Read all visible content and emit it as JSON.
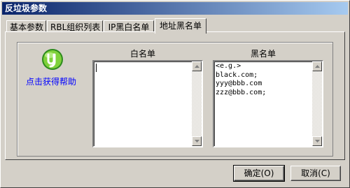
{
  "window": {
    "title": "反垃圾参数"
  },
  "tabs": [
    {
      "label": "基本参数"
    },
    {
      "label": "RBL组织列表"
    },
    {
      "label": "IP黑白名单"
    },
    {
      "label": "地址黑名单",
      "active": true
    }
  ],
  "help": {
    "icon": "help-book-icon",
    "label": "点击获得帮助"
  },
  "whitelist": {
    "label": "白名单",
    "text": ""
  },
  "blacklist": {
    "label": "黑名单",
    "text": "<e.g.>\nblack.com;\nyyy@bbb.com\nzzz@bbb.com;"
  },
  "buttons": {
    "ok_label": "确定(O)",
    "cancel_label": "取消(C)"
  },
  "colors": {
    "titlebar_start": "#0a246a",
    "titlebar_end": "#a6caf0",
    "face": "#d4d0c8",
    "link": "#0000ff"
  }
}
